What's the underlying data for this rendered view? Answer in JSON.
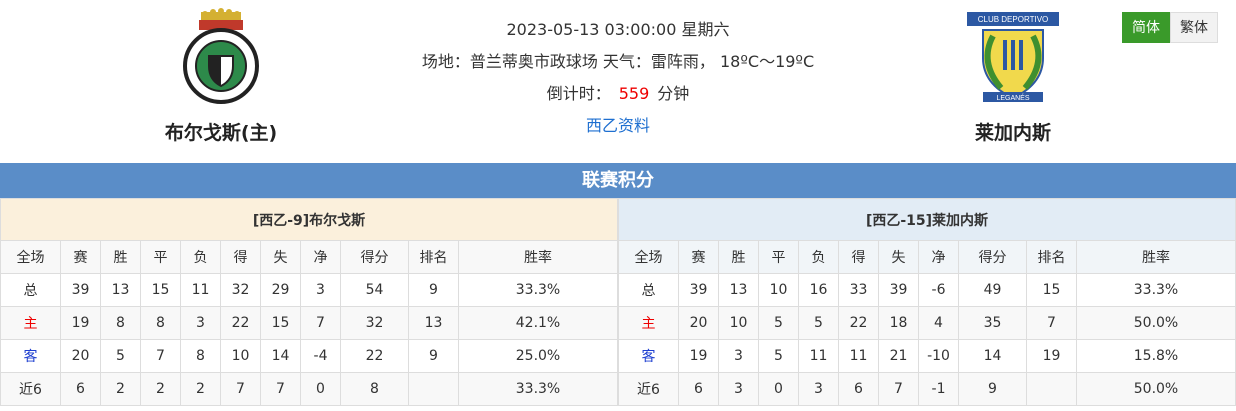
{
  "header": {
    "datetime": "2023-05-13 03:00:00 星期六",
    "venue_weather": "场地：普兰蒂奥市政球场 天气：雷阵雨， 18ºC～19ºC",
    "countdown_label": "倒计时：",
    "countdown_value": "559",
    "countdown_unit": "分钟",
    "league_link": "西乙资料"
  },
  "home_team": {
    "name": "布尔戈斯(主)"
  },
  "away_team": {
    "name": "莱加内斯"
  },
  "lang": {
    "simplified": "简体",
    "traditional": "繁体"
  },
  "section_title": "联赛积分",
  "columns": [
    "全场",
    "赛",
    "胜",
    "平",
    "负",
    "得",
    "失",
    "净",
    "得分",
    "排名",
    "胜率"
  ],
  "standings": [
    {
      "title": "[西乙-9]布尔戈斯",
      "rows": [
        [
          "总",
          "39",
          "13",
          "15",
          "11",
          "32",
          "29",
          "3",
          "54",
          "9",
          "33.3%"
        ],
        [
          "主",
          "19",
          "8",
          "8",
          "3",
          "22",
          "15",
          "7",
          "32",
          "13",
          "42.1%"
        ],
        [
          "客",
          "20",
          "5",
          "7",
          "8",
          "10",
          "14",
          "-4",
          "22",
          "9",
          "25.0%"
        ],
        [
          "近6",
          "6",
          "2",
          "2",
          "2",
          "7",
          "7",
          "0",
          "8",
          "",
          "33.3%"
        ]
      ]
    },
    {
      "title": "[西乙-15]莱加内斯",
      "rows": [
        [
          "总",
          "39",
          "13",
          "10",
          "16",
          "33",
          "39",
          "-6",
          "49",
          "15",
          "33.3%"
        ],
        [
          "主",
          "20",
          "10",
          "5",
          "5",
          "22",
          "18",
          "4",
          "35",
          "7",
          "50.0%"
        ],
        [
          "客",
          "19",
          "3",
          "5",
          "11",
          "11",
          "21",
          "-10",
          "14",
          "19",
          "15.8%"
        ],
        [
          "近6",
          "6",
          "3",
          "0",
          "3",
          "6",
          "7",
          "-1",
          "9",
          "",
          "50.0%"
        ]
      ]
    }
  ]
}
